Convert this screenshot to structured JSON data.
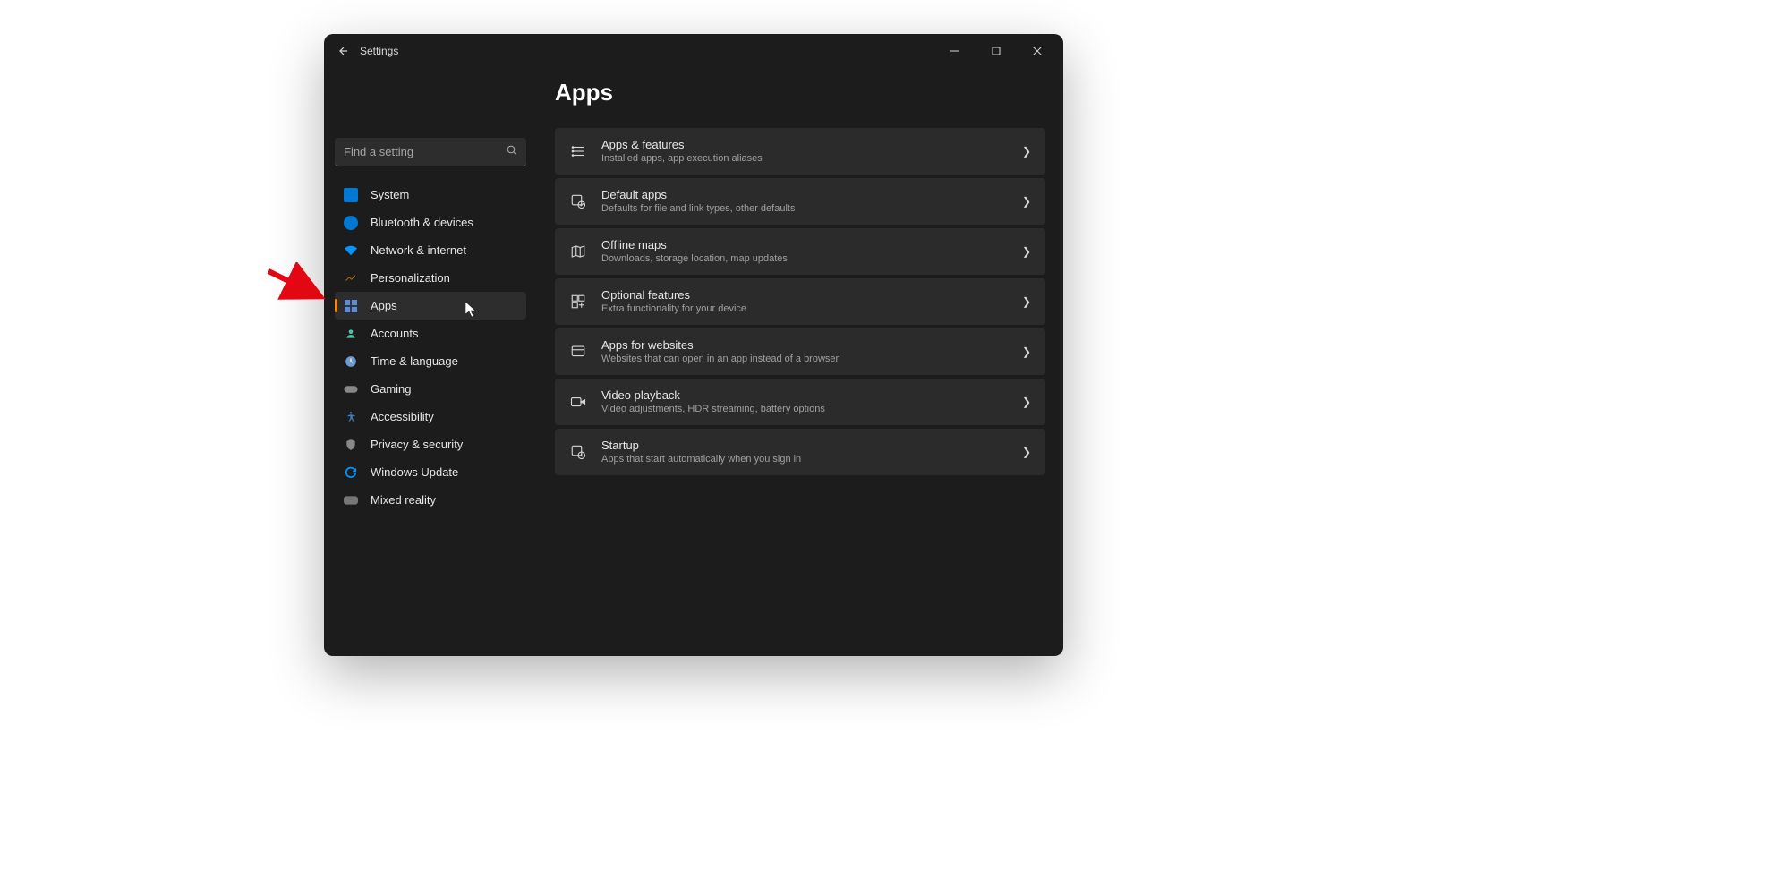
{
  "window": {
    "title": "Settings"
  },
  "search": {
    "placeholder": "Find a setting"
  },
  "sidebar": {
    "items": [
      {
        "label": "System",
        "icon": "system"
      },
      {
        "label": "Bluetooth & devices",
        "icon": "bluetooth"
      },
      {
        "label": "Network & internet",
        "icon": "network"
      },
      {
        "label": "Personalization",
        "icon": "personalization"
      },
      {
        "label": "Apps",
        "icon": "apps",
        "selected": true
      },
      {
        "label": "Accounts",
        "icon": "accounts"
      },
      {
        "label": "Time & language",
        "icon": "time"
      },
      {
        "label": "Gaming",
        "icon": "gaming"
      },
      {
        "label": "Accessibility",
        "icon": "accessibility"
      },
      {
        "label": "Privacy & security",
        "icon": "privacy"
      },
      {
        "label": "Windows Update",
        "icon": "update"
      },
      {
        "label": "Mixed reality",
        "icon": "mixedreality"
      }
    ]
  },
  "page": {
    "title": "Apps"
  },
  "cards": [
    {
      "title": "Apps & features",
      "subtitle": "Installed apps, app execution aliases",
      "icon": "apps-features"
    },
    {
      "title": "Default apps",
      "subtitle": "Defaults for file and link types, other defaults",
      "icon": "default-apps"
    },
    {
      "title": "Offline maps",
      "subtitle": "Downloads, storage location, map updates",
      "icon": "offline-maps"
    },
    {
      "title": "Optional features",
      "subtitle": "Extra functionality for your device",
      "icon": "optional-features"
    },
    {
      "title": "Apps for websites",
      "subtitle": "Websites that can open in an app instead of a browser",
      "icon": "apps-websites"
    },
    {
      "title": "Video playback",
      "subtitle": "Video adjustments, HDR streaming, battery options",
      "icon": "video-playback"
    },
    {
      "title": "Startup",
      "subtitle": "Apps that start automatically when you sign in",
      "icon": "startup"
    }
  ]
}
